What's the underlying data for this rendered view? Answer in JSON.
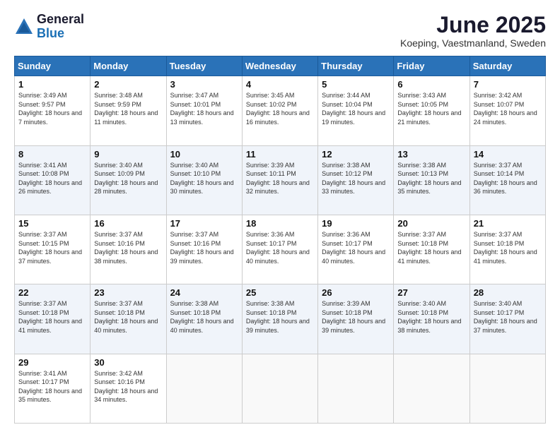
{
  "logo": {
    "general": "General",
    "blue": "Blue"
  },
  "title": {
    "month_year": "June 2025",
    "location": "Koeping, Vaestmanland, Sweden"
  },
  "days_of_week": [
    "Sunday",
    "Monday",
    "Tuesday",
    "Wednesday",
    "Thursday",
    "Friday",
    "Saturday"
  ],
  "weeks": [
    [
      {
        "day": "1",
        "sunrise": "3:49 AM",
        "sunset": "9:57 PM",
        "daylight": "18 hours and 7 minutes."
      },
      {
        "day": "2",
        "sunrise": "3:48 AM",
        "sunset": "9:59 PM",
        "daylight": "18 hours and 11 minutes."
      },
      {
        "day": "3",
        "sunrise": "3:47 AM",
        "sunset": "10:01 PM",
        "daylight": "18 hours and 13 minutes."
      },
      {
        "day": "4",
        "sunrise": "3:45 AM",
        "sunset": "10:02 PM",
        "daylight": "18 hours and 16 minutes."
      },
      {
        "day": "5",
        "sunrise": "3:44 AM",
        "sunset": "10:04 PM",
        "daylight": "18 hours and 19 minutes."
      },
      {
        "day": "6",
        "sunrise": "3:43 AM",
        "sunset": "10:05 PM",
        "daylight": "18 hours and 21 minutes."
      },
      {
        "day": "7",
        "sunrise": "3:42 AM",
        "sunset": "10:07 PM",
        "daylight": "18 hours and 24 minutes."
      }
    ],
    [
      {
        "day": "8",
        "sunrise": "3:41 AM",
        "sunset": "10:08 PM",
        "daylight": "18 hours and 26 minutes."
      },
      {
        "day": "9",
        "sunrise": "3:40 AM",
        "sunset": "10:09 PM",
        "daylight": "18 hours and 28 minutes."
      },
      {
        "day": "10",
        "sunrise": "3:40 AM",
        "sunset": "10:10 PM",
        "daylight": "18 hours and 30 minutes."
      },
      {
        "day": "11",
        "sunrise": "3:39 AM",
        "sunset": "10:11 PM",
        "daylight": "18 hours and 32 minutes."
      },
      {
        "day": "12",
        "sunrise": "3:38 AM",
        "sunset": "10:12 PM",
        "daylight": "18 hours and 33 minutes."
      },
      {
        "day": "13",
        "sunrise": "3:38 AM",
        "sunset": "10:13 PM",
        "daylight": "18 hours and 35 minutes."
      },
      {
        "day": "14",
        "sunrise": "3:37 AM",
        "sunset": "10:14 PM",
        "daylight": "18 hours and 36 minutes."
      }
    ],
    [
      {
        "day": "15",
        "sunrise": "3:37 AM",
        "sunset": "10:15 PM",
        "daylight": "18 hours and 37 minutes."
      },
      {
        "day": "16",
        "sunrise": "3:37 AM",
        "sunset": "10:16 PM",
        "daylight": "18 hours and 38 minutes."
      },
      {
        "day": "17",
        "sunrise": "3:37 AM",
        "sunset": "10:16 PM",
        "daylight": "18 hours and 39 minutes."
      },
      {
        "day": "18",
        "sunrise": "3:36 AM",
        "sunset": "10:17 PM",
        "daylight": "18 hours and 40 minutes."
      },
      {
        "day": "19",
        "sunrise": "3:36 AM",
        "sunset": "10:17 PM",
        "daylight": "18 hours and 40 minutes."
      },
      {
        "day": "20",
        "sunrise": "3:37 AM",
        "sunset": "10:18 PM",
        "daylight": "18 hours and 41 minutes."
      },
      {
        "day": "21",
        "sunrise": "3:37 AM",
        "sunset": "10:18 PM",
        "daylight": "18 hours and 41 minutes."
      }
    ],
    [
      {
        "day": "22",
        "sunrise": "3:37 AM",
        "sunset": "10:18 PM",
        "daylight": "18 hours and 41 minutes."
      },
      {
        "day": "23",
        "sunrise": "3:37 AM",
        "sunset": "10:18 PM",
        "daylight": "18 hours and 40 minutes."
      },
      {
        "day": "24",
        "sunrise": "3:38 AM",
        "sunset": "10:18 PM",
        "daylight": "18 hours and 40 minutes."
      },
      {
        "day": "25",
        "sunrise": "3:38 AM",
        "sunset": "10:18 PM",
        "daylight": "18 hours and 39 minutes."
      },
      {
        "day": "26",
        "sunrise": "3:39 AM",
        "sunset": "10:18 PM",
        "daylight": "18 hours and 39 minutes."
      },
      {
        "day": "27",
        "sunrise": "3:40 AM",
        "sunset": "10:18 PM",
        "daylight": "18 hours and 38 minutes."
      },
      {
        "day": "28",
        "sunrise": "3:40 AM",
        "sunset": "10:17 PM",
        "daylight": "18 hours and 37 minutes."
      }
    ],
    [
      {
        "day": "29",
        "sunrise": "3:41 AM",
        "sunset": "10:17 PM",
        "daylight": "18 hours and 35 minutes."
      },
      {
        "day": "30",
        "sunrise": "3:42 AM",
        "sunset": "10:16 PM",
        "daylight": "18 hours and 34 minutes."
      },
      null,
      null,
      null,
      null,
      null
    ]
  ]
}
